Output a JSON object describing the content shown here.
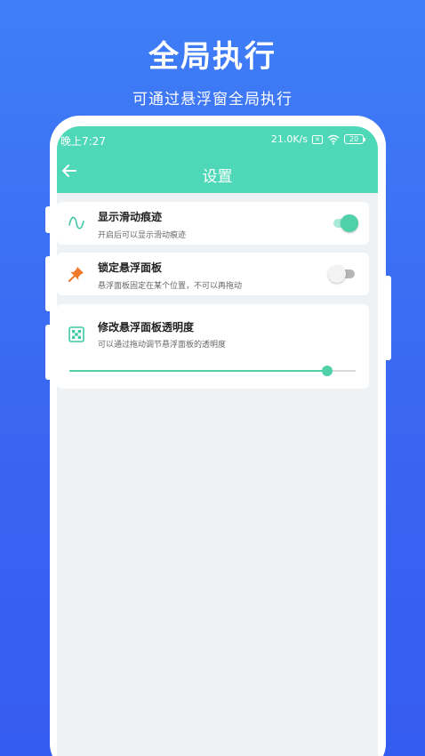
{
  "promo": {
    "title": "全局执行",
    "subtitle": "可通过悬浮窗全局执行"
  },
  "status_bar": {
    "time": "晚上7:27",
    "speed": "21.0K/s",
    "sim": "✕",
    "battery": "20"
  },
  "appbar": {
    "title": "设置",
    "back_icon": "arrow-left-icon"
  },
  "settings": [
    {
      "title": "显示滑动痕迹",
      "desc": "开启后可以显示滑动痕迹",
      "icon": "trace-wave-icon",
      "toggle_on": true
    },
    {
      "title": "锁定悬浮面板",
      "desc": "悬浮面板固定在某个位置，不可以再拖动",
      "icon": "pin-icon",
      "toggle_on": false
    },
    {
      "title": "修改悬浮面板透明度",
      "desc": "可以通过拖动调节悬浮面板的透明度",
      "icon": "opacity-grid-icon",
      "slider_value": 0.9
    }
  ],
  "colors": {
    "accent": "#4fd8b8",
    "background_top": "#3f7ef6",
    "pin": "#f07a2c"
  }
}
